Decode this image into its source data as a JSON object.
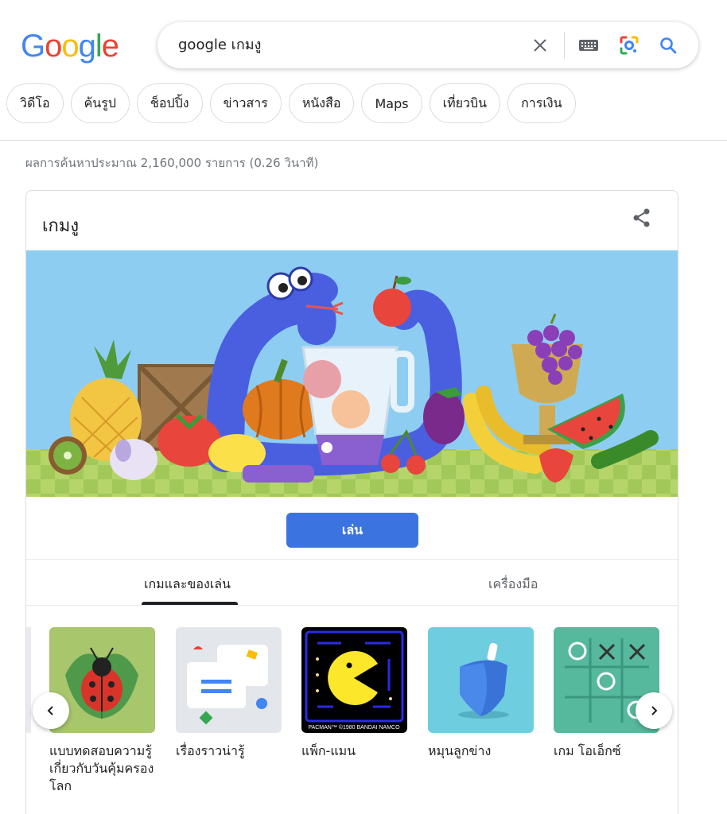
{
  "logo": [
    "G",
    "o",
    "o",
    "g",
    "l",
    "e"
  ],
  "search": {
    "query": "google เกมงู"
  },
  "chips": [
    "วิดีโอ",
    "ค้นรูป",
    "ช็อปปิ้ง",
    "ข่าวสาร",
    "หนังสือ",
    "Maps",
    "เที่ยวบิน",
    "การเงิน"
  ],
  "stats": "ผลการค้นหาประมาณ 2,160,000 รายการ (0.26 วินาที)",
  "card": {
    "title": "เกมงู",
    "play_label": "เล่น",
    "tabs": [
      "เกมและของเล่น",
      "เครื่องมือ"
    ],
    "games": [
      {
        "label": "แบบทดสอบความรู้เกี่ยวกับวันคุ้มครองโลก",
        "icon": "ladybug-icon"
      },
      {
        "label": "เรื่องราวน่ารู้",
        "icon": "cards-icon"
      },
      {
        "label": "แพ็ก-แมน",
        "icon": "pacman-icon",
        "caption": "PACMAN™ ©1980 BANDAI NAMCO"
      },
      {
        "label": "หมุนลูกข่าง",
        "icon": "dreidel-icon"
      },
      {
        "label": "เกม โอเอ็กซ์",
        "icon": "tic-tac-toe-icon"
      }
    ]
  },
  "colors": {
    "blue": "#4285F4",
    "red": "#EA4335",
    "yellow": "#FBBC05",
    "green": "#34A853",
    "button": "#3b74e0"
  }
}
